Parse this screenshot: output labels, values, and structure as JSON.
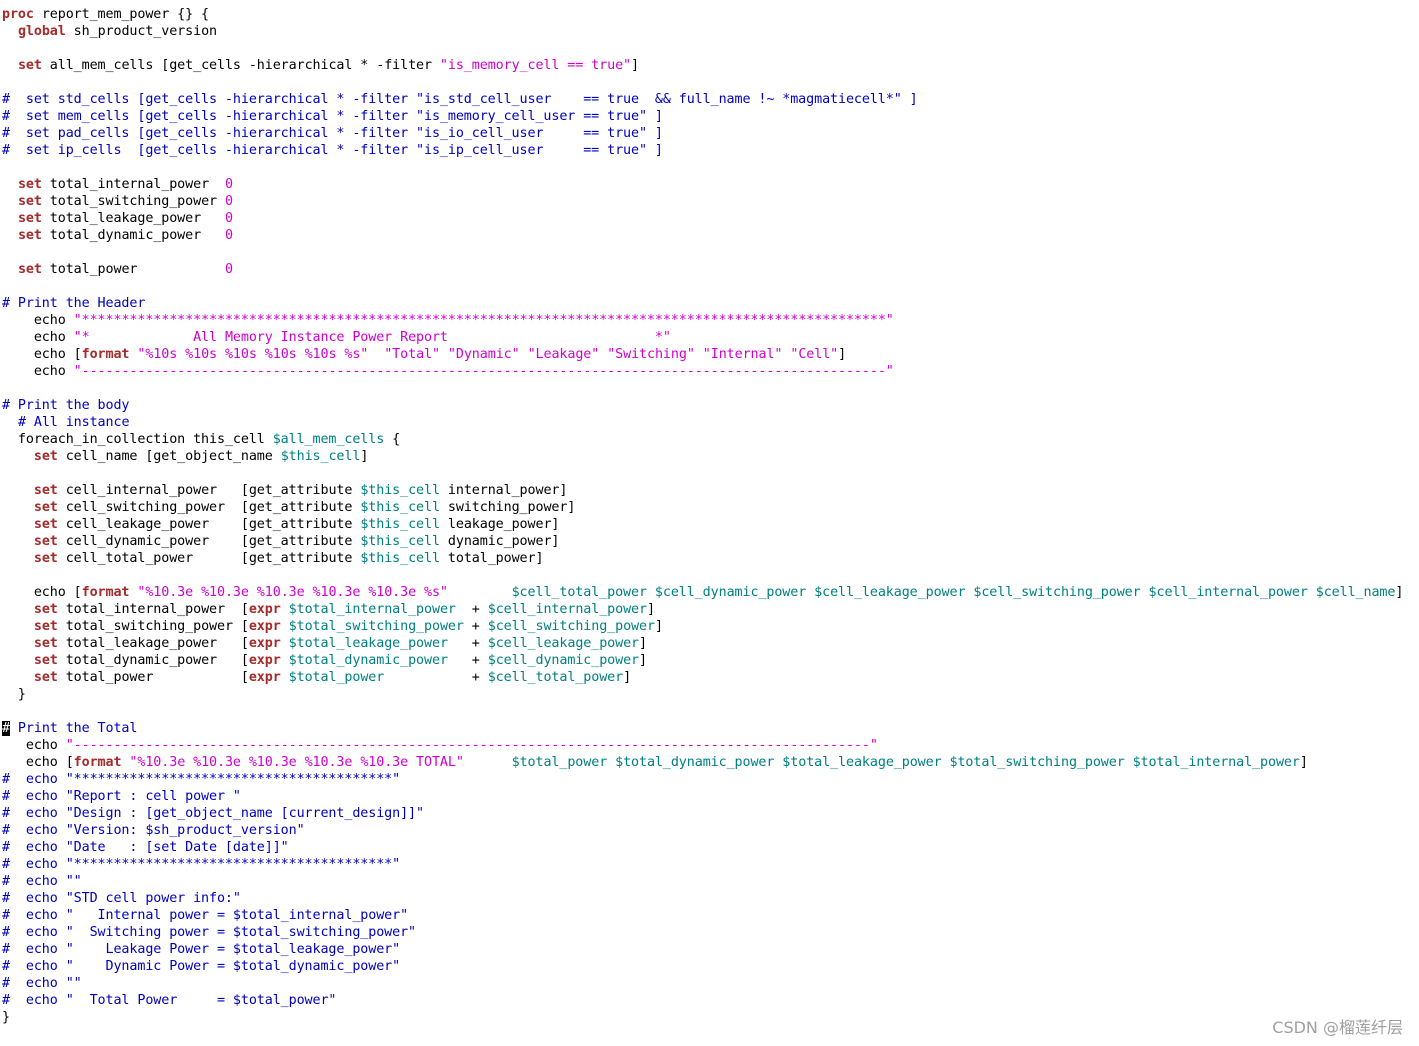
{
  "colors": {
    "background": "#ffffff",
    "keyword": "#a52a2a",
    "comment": "#0000c0",
    "string": "#d000d0",
    "number": "#d000d0",
    "variable": "#008080",
    "plain": "#000000",
    "watermark": "#a0a0a0"
  },
  "watermark": "CSDN @榴莲纤层",
  "editor": {
    "lines": [
      [
        [
          "k",
          "proc"
        ],
        [
          "p",
          " report_mem_power {} {"
        ]
      ],
      [
        [
          "p",
          "  "
        ],
        [
          "k",
          "global"
        ],
        [
          "p",
          " sh_product_version"
        ]
      ],
      [],
      [
        [
          "p",
          "  "
        ],
        [
          "k",
          "set"
        ],
        [
          "p",
          " all_mem_cells [get_cells -hierarchical * -filter "
        ],
        [
          "s",
          "\"is_memory_cell == true\""
        ],
        [
          "p",
          "]"
        ]
      ],
      [],
      [
        [
          "c",
          "#  set std_cells [get_cells -hierarchical * -filter \"is_std_cell_user    == true  && full_name !~ *magmatiecell*\" ]"
        ]
      ],
      [
        [
          "c",
          "#  set mem_cells [get_cells -hierarchical * -filter \"is_memory_cell_user == true\" ]"
        ]
      ],
      [
        [
          "c",
          "#  set pad_cells [get_cells -hierarchical * -filter \"is_io_cell_user     == true\" ]"
        ]
      ],
      [
        [
          "c",
          "#  set ip_cells  [get_cells -hierarchical * -filter \"is_ip_cell_user     == true\" ]"
        ]
      ],
      [],
      [
        [
          "p",
          "  "
        ],
        [
          "k",
          "set"
        ],
        [
          "p",
          " total_internal_power  "
        ],
        [
          "n",
          "0"
        ]
      ],
      [
        [
          "p",
          "  "
        ],
        [
          "k",
          "set"
        ],
        [
          "p",
          " total_switching_power "
        ],
        [
          "n",
          "0"
        ]
      ],
      [
        [
          "p",
          "  "
        ],
        [
          "k",
          "set"
        ],
        [
          "p",
          " total_leakage_power   "
        ],
        [
          "n",
          "0"
        ]
      ],
      [
        [
          "p",
          "  "
        ],
        [
          "k",
          "set"
        ],
        [
          "p",
          " total_dynamic_power   "
        ],
        [
          "n",
          "0"
        ]
      ],
      [],
      [
        [
          "p",
          "  "
        ],
        [
          "k",
          "set"
        ],
        [
          "p",
          " total_power           "
        ],
        [
          "n",
          "0"
        ]
      ],
      [],
      [
        [
          "c",
          "# Print the Header"
        ]
      ],
      [
        [
          "p",
          "    echo "
        ],
        [
          "s",
          "\"*****************************************************************************************************\""
        ]
      ],
      [
        [
          "p",
          "    echo "
        ],
        [
          "s",
          "\"*             All Memory Instance Power Report                          *\""
        ]
      ],
      [
        [
          "p",
          "    echo ["
        ],
        [
          "k",
          "format"
        ],
        [
          "p",
          " "
        ],
        [
          "s",
          "\"%10s %10s %10s %10s %10s %s\""
        ],
        [
          "p",
          "  "
        ],
        [
          "s",
          "\"Total\""
        ],
        [
          "p",
          " "
        ],
        [
          "s",
          "\"Dynamic\""
        ],
        [
          "p",
          " "
        ],
        [
          "s",
          "\"Leakage\""
        ],
        [
          "p",
          " "
        ],
        [
          "s",
          "\"Switching\""
        ],
        [
          "p",
          " "
        ],
        [
          "s",
          "\"Internal\""
        ],
        [
          "p",
          " "
        ],
        [
          "s",
          "\"Cell\""
        ],
        [
          "p",
          "]"
        ]
      ],
      [
        [
          "p",
          "    echo "
        ],
        [
          "s",
          "\"-----------------------------------------------------------------------------------------------------\""
        ]
      ],
      [],
      [
        [
          "c",
          "# Print the body"
        ]
      ],
      [
        [
          "p",
          "  "
        ],
        [
          "c",
          "# All instance"
        ]
      ],
      [
        [
          "p",
          "  foreach_in_collection this_cell "
        ],
        [
          "v",
          "$all_mem_cells"
        ],
        [
          "p",
          " {"
        ]
      ],
      [
        [
          "p",
          "    "
        ],
        [
          "k",
          "set"
        ],
        [
          "p",
          " cell_name [get_object_name "
        ],
        [
          "v",
          "$this_cell"
        ],
        [
          "p",
          "]"
        ]
      ],
      [],
      [
        [
          "p",
          "    "
        ],
        [
          "k",
          "set"
        ],
        [
          "p",
          " cell_internal_power   [get_attribute "
        ],
        [
          "v",
          "$this_cell"
        ],
        [
          "p",
          " internal_power]"
        ]
      ],
      [
        [
          "p",
          "    "
        ],
        [
          "k",
          "set"
        ],
        [
          "p",
          " cell_switching_power  [get_attribute "
        ],
        [
          "v",
          "$this_cell"
        ],
        [
          "p",
          " switching_power]"
        ]
      ],
      [
        [
          "p",
          "    "
        ],
        [
          "k",
          "set"
        ],
        [
          "p",
          " cell_leakage_power    [get_attribute "
        ],
        [
          "v",
          "$this_cell"
        ],
        [
          "p",
          " leakage_power]"
        ]
      ],
      [
        [
          "p",
          "    "
        ],
        [
          "k",
          "set"
        ],
        [
          "p",
          " cell_dynamic_power    [get_attribute "
        ],
        [
          "v",
          "$this_cell"
        ],
        [
          "p",
          " dynamic_power]"
        ]
      ],
      [
        [
          "p",
          "    "
        ],
        [
          "k",
          "set"
        ],
        [
          "p",
          " cell_total_power      [get_attribute "
        ],
        [
          "v",
          "$this_cell"
        ],
        [
          "p",
          " total_power]"
        ]
      ],
      [],
      [
        [
          "p",
          "    echo ["
        ],
        [
          "k",
          "format"
        ],
        [
          "p",
          " "
        ],
        [
          "s",
          "\"%10.3e %10.3e %10.3e %10.3e %10.3e %s\""
        ],
        [
          "p",
          "        "
        ],
        [
          "v",
          "$cell_total_power $cell_dynamic_power $cell_leakage_power $cell_switching_power $cell_internal_power $cell_name"
        ],
        [
          "p",
          "]"
        ]
      ],
      [
        [
          "p",
          "    "
        ],
        [
          "k",
          "set"
        ],
        [
          "p",
          " total_internal_power  ["
        ],
        [
          "k",
          "expr"
        ],
        [
          "p",
          " "
        ],
        [
          "v",
          "$total_internal_power"
        ],
        [
          "p",
          "  + "
        ],
        [
          "v",
          "$cell_internal_power"
        ],
        [
          "p",
          "]"
        ]
      ],
      [
        [
          "p",
          "    "
        ],
        [
          "k",
          "set"
        ],
        [
          "p",
          " total_switching_power ["
        ],
        [
          "k",
          "expr"
        ],
        [
          "p",
          " "
        ],
        [
          "v",
          "$total_switching_power"
        ],
        [
          "p",
          " + "
        ],
        [
          "v",
          "$cell_switching_power"
        ],
        [
          "p",
          "]"
        ]
      ],
      [
        [
          "p",
          "    "
        ],
        [
          "k",
          "set"
        ],
        [
          "p",
          " total_leakage_power   ["
        ],
        [
          "k",
          "expr"
        ],
        [
          "p",
          " "
        ],
        [
          "v",
          "$total_leakage_power"
        ],
        [
          "p",
          "   + "
        ],
        [
          "v",
          "$cell_leakage_power"
        ],
        [
          "p",
          "]"
        ]
      ],
      [
        [
          "p",
          "    "
        ],
        [
          "k",
          "set"
        ],
        [
          "p",
          " total_dynamic_power   ["
        ],
        [
          "k",
          "expr"
        ],
        [
          "p",
          " "
        ],
        [
          "v",
          "$total_dynamic_power"
        ],
        [
          "p",
          "   + "
        ],
        [
          "v",
          "$cell_dynamic_power"
        ],
        [
          "p",
          "]"
        ]
      ],
      [
        [
          "p",
          "    "
        ],
        [
          "k",
          "set"
        ],
        [
          "p",
          " total_power           ["
        ],
        [
          "k",
          "expr"
        ],
        [
          "p",
          " "
        ],
        [
          "v",
          "$total_power"
        ],
        [
          "p",
          "           + "
        ],
        [
          "v",
          "$cell_total_power"
        ],
        [
          "p",
          "]"
        ]
      ],
      [
        [
          "p",
          "  }"
        ]
      ],
      [],
      [
        [
          "x",
          "#"
        ],
        [
          "c",
          " Print the Total"
        ]
      ],
      [
        [
          "p",
          "   echo "
        ],
        [
          "s",
          "\"----------------------------------------------------------------------------------------------------\""
        ]
      ],
      [
        [
          "p",
          "   echo ["
        ],
        [
          "k",
          "format"
        ],
        [
          "p",
          " "
        ],
        [
          "s",
          "\"%10.3e %10.3e %10.3e %10.3e %10.3e TOTAL\""
        ],
        [
          "p",
          "      "
        ],
        [
          "v",
          "$total_power $total_dynamic_power $total_leakage_power $total_switching_power $total_internal_power"
        ],
        [
          "p",
          "]"
        ]
      ],
      [
        [
          "c",
          "#  echo \"****************************************\""
        ]
      ],
      [
        [
          "c",
          "#  echo \"Report : cell power \""
        ]
      ],
      [
        [
          "c",
          "#  echo \"Design : [get_object_name [current_design]]\""
        ]
      ],
      [
        [
          "c",
          "#  echo \"Version: $sh_product_version\""
        ]
      ],
      [
        [
          "c",
          "#  echo \"Date   : [set Date [date]]\""
        ]
      ],
      [
        [
          "c",
          "#  echo \"****************************************\""
        ]
      ],
      [
        [
          "c",
          "#  echo \"\""
        ]
      ],
      [
        [
          "c",
          "#  echo \"STD cell power info:\""
        ]
      ],
      [
        [
          "c",
          "#  echo \"   Internal power = $total_internal_power\""
        ]
      ],
      [
        [
          "c",
          "#  echo \"  Switching power = $total_switching_power\""
        ]
      ],
      [
        [
          "c",
          "#  echo \"    Leakage Power = $total_leakage_power\""
        ]
      ],
      [
        [
          "c",
          "#  echo \"    Dynamic Power = $total_dynamic_power\""
        ]
      ],
      [
        [
          "c",
          "#  echo \"\""
        ]
      ],
      [
        [
          "c",
          "#  echo \"  Total Power     = $total_power\""
        ]
      ],
      [
        [
          "p",
          "}"
        ]
      ]
    ]
  }
}
